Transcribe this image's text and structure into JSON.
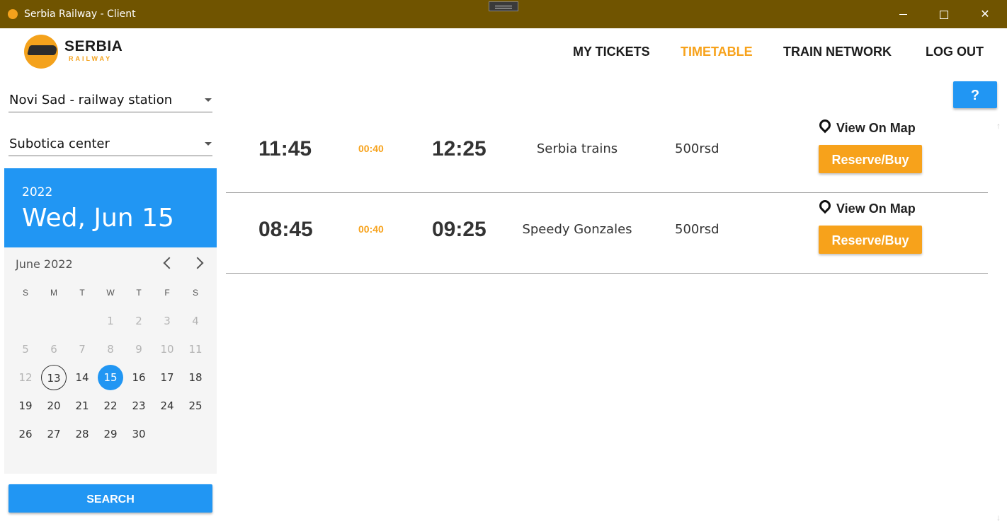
{
  "window": {
    "title": "Serbia Railway - Client"
  },
  "logo": {
    "brand": "SERBIA",
    "sub": "RAILWAY"
  },
  "nav": {
    "my_tickets": "MY TICKETS",
    "timetable": "TIMETABLE",
    "train_network": "TRAIN NETWORK",
    "log_out": "LOG OUT"
  },
  "help": {
    "label": "?"
  },
  "search": {
    "from": "Novi Sad - railway station",
    "to": "Subotica center",
    "button": "SEARCH"
  },
  "calendar": {
    "year": "2022",
    "selected_date": "Wed, Jun 15",
    "month_label": "June 2022",
    "weekdays": [
      "S",
      "M",
      "T",
      "W",
      "T",
      "F",
      "S"
    ],
    "days": [
      "1",
      "2",
      "3",
      "4",
      "5",
      "6",
      "7",
      "8",
      "9",
      "10",
      "11",
      "12",
      "13",
      "14",
      "15",
      "16",
      "17",
      "18",
      "19",
      "20",
      "21",
      "22",
      "23",
      "24",
      "25",
      "26",
      "27",
      "28",
      "29",
      "30"
    ],
    "today": 13,
    "selected": 15,
    "first_enabled": 13
  },
  "results": [
    {
      "departure": "11:45",
      "duration": "00:40",
      "arrival": "12:25",
      "company": "Serbia trains",
      "price": "500rsd",
      "map_label": "View On Map",
      "buy_label": "Reserve/Buy"
    },
    {
      "departure": "08:45",
      "duration": "00:40",
      "arrival": "09:25",
      "company": "Speedy Gonzales",
      "price": "500rsd",
      "map_label": "View On Map",
      "buy_label": "Reserve/Buy"
    }
  ],
  "colors": {
    "titlebar": "#705400",
    "accent": "#f7a21b",
    "primary": "#2196f3"
  }
}
